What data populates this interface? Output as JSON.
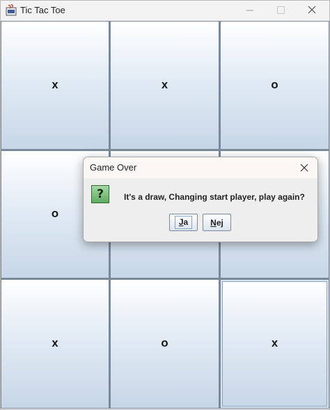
{
  "window": {
    "title": "Tic Tac Toe",
    "controls": {
      "minimize": "minimize-icon",
      "maximize": "maximize-icon",
      "close": "close-icon"
    }
  },
  "board": {
    "cells": [
      "X",
      "X",
      "O",
      "O",
      "",
      "",
      "X",
      "O",
      "X"
    ]
  },
  "dialog": {
    "title": "Game Over",
    "icon": "question-icon",
    "icon_glyph": "?",
    "message": "It's a draw, Changing start player, play again?",
    "yes": {
      "mnemonic": "J",
      "rest": "a"
    },
    "no": {
      "mnemonic": "N",
      "rest": "ej"
    }
  }
}
